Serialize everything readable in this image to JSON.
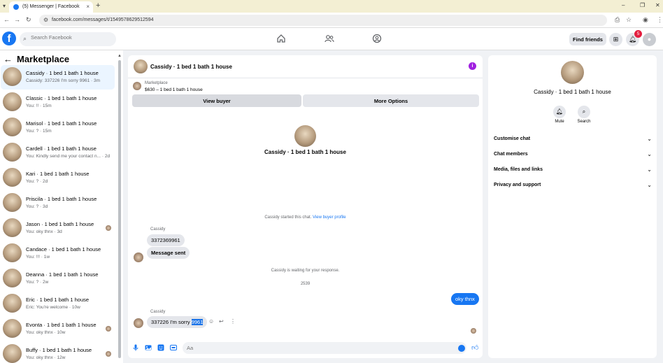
{
  "browser": {
    "tab_title": "(5) Messenger | Facebook",
    "tab_close": "×",
    "new_tab": "+",
    "url": "facebook.com/messages/t/1549578629512594",
    "win_min": "–",
    "win_max": "❐",
    "win_close": "✕"
  },
  "fb_header": {
    "search_placeholder": "Search Facebook",
    "find_friends": "Find friends",
    "notification_count": "5"
  },
  "sidebar": {
    "title": "Marketplace",
    "conversations": [
      {
        "name": "Cassidy · 1 bed 1 bath 1 house",
        "preview": "Cassidy: 337226 I'm sorry 9961 · 3m"
      },
      {
        "name": "Classic · 1 bed 1 bath 1 house",
        "preview": "You: !! · 15m"
      },
      {
        "name": "Marisol · 1 bed 1 bath 1 house",
        "preview": "You: ? · 15m"
      },
      {
        "name": "Cardell · 1 bed 1 bath 1 house",
        "preview": "You: Kindly send me your contact n... · 2d"
      },
      {
        "name": "Kari · 1 bed 1 bath 1 house",
        "preview": "You: ? · 2d"
      },
      {
        "name": "Priscila · 1 bed 1 bath 1 house",
        "preview": "You: ? · 3d"
      },
      {
        "name": "Jason · 1 bed 1 bath 1 house",
        "preview": "You: oky thnx · 3d"
      },
      {
        "name": "Candace · 1 bed 1 bath 1 house",
        "preview": "You: !!! · 1w"
      },
      {
        "name": "Deanna · 1 bed 1 bath 1 house",
        "preview": "You: ? · 2w"
      },
      {
        "name": "Eric · 1 bed 1 bath 1 house",
        "preview": "Eric: You're welcome · 10w"
      },
      {
        "name": "Evonta · 1 bed 1 bath 1 house",
        "preview": "You: oky thnx · 10w"
      },
      {
        "name": "Buffy · 1 bed 1 bath 1 house",
        "preview": "You: oky thnx · 12w"
      }
    ]
  },
  "chat": {
    "header_name": "Cassidy · 1 bed 1 bath 1 house",
    "marketplace_label": "Marketplace",
    "listing": "$630 – 1 bed 1 bath 1 house",
    "view_buyer": "View buyer",
    "more_options": "More Options",
    "hero_name": "Cassidy · 1 bed 1 bath 1 house",
    "started_text": "Cassidy started this chat.",
    "view_profile": "View buyer profile",
    "sender1": "Cassidy",
    "msg1": "3372369961",
    "msg2": "Message sent",
    "waiting": "Cassidy is waiting for your response.",
    "time": "2539",
    "my_msg": "oky thnx",
    "sender2": "Cassidy",
    "msg3_prefix": "337226 I'm sorry ",
    "msg3_highlight": "9961",
    "composer_placeholder": "Aa"
  },
  "right_panel": {
    "name": "Cassidy · 1 bed 1 bath 1 house",
    "mute": "Mute",
    "search": "Search",
    "sections": [
      "Customise chat",
      "Chat members",
      "Media, files and links",
      "Privacy and support"
    ]
  },
  "colors": {
    "fb_blue": "#1877f2",
    "badge_red": "#e41e3f",
    "info_purple": "#a020e0"
  }
}
